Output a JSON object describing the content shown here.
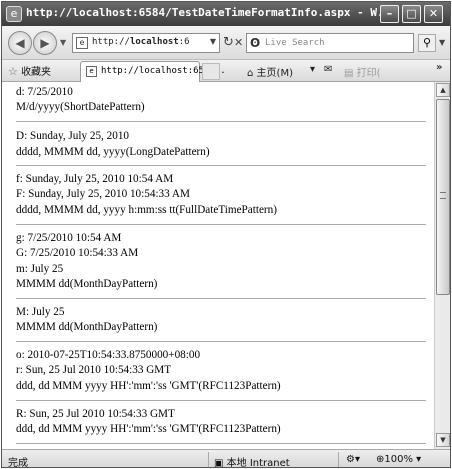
{
  "window": {
    "title": "http://localhost:6584/TestDateTimeFormatInfo.aspx - W...",
    "controls": {
      "minimize": "–",
      "maximize": "□",
      "close": "✕"
    }
  },
  "address_bar": {
    "url_prefix": "http://",
    "url_host": "localhost",
    "url_rest": ":6",
    "search_placeholder": "Live Search",
    "icons": {
      "back": "arrow-left-icon",
      "forward": "arrow-right-icon",
      "refresh": "refresh-icon",
      "stop": "stop-icon",
      "search": "magnifier-icon"
    }
  },
  "tab_bar": {
    "favorites_label": "收藏夹",
    "tab_title": "http://localhost:65 ...",
    "home_label": "主页(M)",
    "print_label": "打印(",
    "chevrons": "»"
  },
  "content": {
    "lines": [
      "d:    7/25/2010",
      "M/d/yyyy(ShortDatePattern)",
      "D:    Sunday, July 25, 2010",
      "dddd, MMMM dd, yyyy(LongDatePattern)",
      "f:    Sunday, July 25, 2010 10:54 AM",
      "F:    Sunday, July 25, 2010 10:54:33 AM",
      "dddd, MMMM dd, yyyy h:mm:ss tt(FullDateTimePattern)",
      "g:    7/25/2010 10:54 AM",
      "G:    7/25/2010 10:54:33 AM",
      "m:    July 25",
      "MMMM dd(MonthDayPattern)",
      "M:    July 25",
      "MMMM dd(MonthDayPattern)",
      "o:    2010-07-25T10:54:33.8750000+08:00",
      "r:    Sun, 25 Jul 2010 10:54:33 GMT",
      "ddd, dd MMM yyyy HH':'mm':'ss 'GMT'(RFC1123Pattern)",
      "R:    Sun, 25 Jul 2010 10:54:33 GMT",
      "ddd, dd MMM yyyy HH':'mm':'ss 'GMT'(RFC1123Pattern)"
    ]
  },
  "status_bar": {
    "status_text": "完成",
    "zone": "本地 Intranet",
    "zoom": "100%"
  }
}
